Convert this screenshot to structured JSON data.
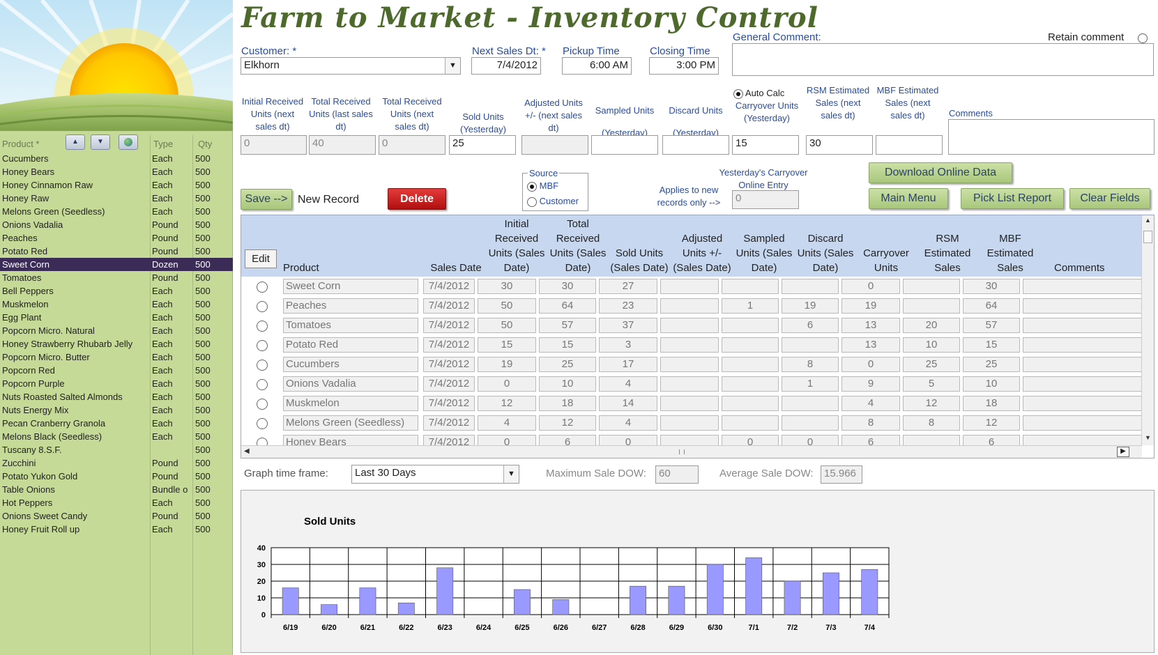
{
  "app": {
    "title": "Farm to Market - Inventory Control"
  },
  "product_list": {
    "headers": {
      "product": "Product *",
      "type": "Type",
      "qty": "Qty"
    },
    "rows": [
      {
        "name": "Cucumbers",
        "type": "Each",
        "qty": "500"
      },
      {
        "name": "Honey Bears",
        "type": "Each",
        "qty": "500"
      },
      {
        "name": "Honey Cinnamon Raw",
        "type": "Each",
        "qty": "500"
      },
      {
        "name": "Honey Raw",
        "type": "Each",
        "qty": "500"
      },
      {
        "name": "Melons Green (Seedless)",
        "type": "Each",
        "qty": "500"
      },
      {
        "name": "Onions Vadalia",
        "type": "Pound",
        "qty": "500"
      },
      {
        "name": "Peaches",
        "type": "Pound",
        "qty": "500"
      },
      {
        "name": "Potato Red",
        "type": "Pound",
        "qty": "500"
      },
      {
        "name": "Sweet Corn",
        "type": "Dozen",
        "qty": "500"
      },
      {
        "name": "Tomatoes",
        "type": "Pound",
        "qty": "500"
      },
      {
        "name": "Bell Peppers",
        "type": "Each",
        "qty": "500"
      },
      {
        "name": "Muskmelon",
        "type": "Each",
        "qty": "500"
      },
      {
        "name": "Egg Plant",
        "type": "Each",
        "qty": "500"
      },
      {
        "name": "Popcorn Micro. Natural",
        "type": "Each",
        "qty": "500"
      },
      {
        "name": "Honey Strawberry Rhubarb Jelly",
        "type": "Each",
        "qty": "500"
      },
      {
        "name": "Popcorn Micro. Butter",
        "type": "Each",
        "qty": "500"
      },
      {
        "name": "Popcorn Red",
        "type": "Each",
        "qty": "500"
      },
      {
        "name": "Popcorn Purple",
        "type": "Each",
        "qty": "500"
      },
      {
        "name": "Nuts Roasted Salted Almonds",
        "type": "Each",
        "qty": "500"
      },
      {
        "name": "Nuts Energy Mix",
        "type": "Each",
        "qty": "500"
      },
      {
        "name": "Pecan Cranberry Granola",
        "type": "Each",
        "qty": "500"
      },
      {
        "name": "Melons Black (Seedless)",
        "type": "Each",
        "qty": "500"
      },
      {
        "name": "Tuscany 8.S.F.",
        "type": "",
        "qty": "500"
      },
      {
        "name": "Zucchini",
        "type": "Pound",
        "qty": "500"
      },
      {
        "name": "Potato Yukon Gold",
        "type": "Pound",
        "qty": "500"
      },
      {
        "name": "Table Onions",
        "type": "Bundle o",
        "qty": "500"
      },
      {
        "name": "Hot Peppers",
        "type": "Each",
        "qty": "500"
      },
      {
        "name": "Onions Sweet Candy",
        "type": "Pound",
        "qty": "500"
      },
      {
        "name": "Honey Fruit Roll up",
        "type": "Each",
        "qty": "500"
      }
    ],
    "selected_index": 8
  },
  "form": {
    "customer_label": "Customer: *",
    "customer_value": "Elkhorn",
    "next_sales_label": "Next Sales Dt: *",
    "next_sales_value": "7/4/2012",
    "pickup_label": "Pickup Time",
    "pickup_value": "6:00 AM",
    "closing_label": "Closing Time",
    "closing_value": "3:00 PM",
    "general_comment_label": "General Comment:",
    "general_comment_value": "",
    "retain_comment_label": "Retain comment"
  },
  "entry": {
    "headers": {
      "initial": "Initial Received Units (next sales dt)",
      "total_last": "Total Received Units (last sales dt)",
      "total_next": "Total Received Units (next sales dt)",
      "sold": "Sold Units (Yesterday)",
      "adjusted": "Adjusted Units +/- (next sales dt)",
      "sampled": "Sampled Units (Yesterday)",
      "discard": "Discard Units (Yesterday)",
      "auto_calc": "Auto Calc",
      "carryover": "Carryover Units (Yesterday)",
      "rsm": "RSM Estimated Sales (next sales dt)",
      "mbf": "MBF Estimated Sales (next sales dt)",
      "comments": "Comments"
    },
    "values": {
      "initial": "0",
      "total_last": "40",
      "total_next": "0",
      "sold": "25",
      "adjusted": "",
      "sampled": "",
      "discard": "",
      "carryover": "15",
      "rsm": "30",
      "mbf": "",
      "comments": ""
    }
  },
  "actions": {
    "save": "Save -->",
    "status": "New Record",
    "delete": "Delete",
    "source_label": "Source",
    "source_mbf": "MBF",
    "source_customer": "Customer",
    "applies_note": "Applies to new records only -->",
    "yesterday_carryover_label": "Yesterday's Carryover Online Entry",
    "yesterday_carryover_value": "0",
    "download": "Download Online Data",
    "main_menu": "Main Menu",
    "pick_list": "Pick List Report",
    "clear": "Clear Fields"
  },
  "grid": {
    "edit_label": "Edit",
    "headers": {
      "product": "Product",
      "sales_date": "Sales Date",
      "initial": "Initial Received Units (Sales Date)",
      "total": "Total Received Units (Sales Date)",
      "sold": "Sold Units (Sales Date)",
      "adjusted": "Adjusted Units +/- (Sales Date)",
      "sampled": "Sampled Units (Sales Date)",
      "discard": "Discard Units (Sales Date)",
      "carryover": "Carryover Units",
      "rsm": "RSM Estimated Sales",
      "mbf": "MBF Estimated Sales",
      "comments": "Comments"
    },
    "rows": [
      {
        "product": "Sweet Corn",
        "date": "7/4/2012",
        "initial": "30",
        "total": "30",
        "sold": "27",
        "adjusted": "",
        "sampled": "",
        "discard": "",
        "carryover": "0",
        "rsm": "",
        "mbf": "30",
        "comments": ""
      },
      {
        "product": "Peaches",
        "date": "7/4/2012",
        "initial": "50",
        "total": "64",
        "sold": "23",
        "adjusted": "",
        "sampled": "1",
        "discard": "19",
        "carryover": "19",
        "rsm": "",
        "mbf": "64",
        "comments": ""
      },
      {
        "product": "Tomatoes",
        "date": "7/4/2012",
        "initial": "50",
        "total": "57",
        "sold": "37",
        "adjusted": "",
        "sampled": "",
        "discard": "6",
        "carryover": "13",
        "rsm": "20",
        "mbf": "57",
        "comments": ""
      },
      {
        "product": "Potato Red",
        "date": "7/4/2012",
        "initial": "15",
        "total": "15",
        "sold": "3",
        "adjusted": "",
        "sampled": "",
        "discard": "",
        "carryover": "13",
        "rsm": "10",
        "mbf": "15",
        "comments": ""
      },
      {
        "product": "Cucumbers",
        "date": "7/4/2012",
        "initial": "19",
        "total": "25",
        "sold": "17",
        "adjusted": "",
        "sampled": "",
        "discard": "8",
        "carryover": "0",
        "rsm": "25",
        "mbf": "25",
        "comments": ""
      },
      {
        "product": "Onions Vadalia",
        "date": "7/4/2012",
        "initial": "0",
        "total": "10",
        "sold": "4",
        "adjusted": "",
        "sampled": "",
        "discard": "1",
        "carryover": "9",
        "rsm": "5",
        "mbf": "10",
        "comments": ""
      },
      {
        "product": "Muskmelon",
        "date": "7/4/2012",
        "initial": "12",
        "total": "18",
        "sold": "14",
        "adjusted": "",
        "sampled": "",
        "discard": "",
        "carryover": "4",
        "rsm": "12",
        "mbf": "18",
        "comments": ""
      },
      {
        "product": "Melons Green (Seedless)",
        "date": "7/4/2012",
        "initial": "4",
        "total": "12",
        "sold": "4",
        "adjusted": "",
        "sampled": "",
        "discard": "",
        "carryover": "8",
        "rsm": "8",
        "mbf": "12",
        "comments": ""
      },
      {
        "product": "Honey Bears",
        "date": "7/4/2012",
        "initial": "0",
        "total": "6",
        "sold": "0",
        "adjusted": "",
        "sampled": "0",
        "discard": "0",
        "carryover": "6",
        "rsm": "",
        "mbf": "6",
        "comments": ""
      }
    ]
  },
  "graph_controls": {
    "timeframe_label": "Graph time frame:",
    "timeframe_value": "Last 30 Days",
    "max_label": "Maximum Sale DOW:",
    "max_value": "60",
    "avg_label": "Average Sale DOW:",
    "avg_value": "15.966"
  },
  "chart_data": {
    "type": "bar",
    "title": "Sold Units",
    "categories": [
      "6/19",
      "6/20",
      "6/21",
      "6/22",
      "6/23",
      "6/24",
      "6/25",
      "6/26",
      "6/27",
      "6/28",
      "6/29",
      "6/30",
      "7/1",
      "7/2",
      "7/3",
      "7/4"
    ],
    "values": [
      16,
      6,
      16,
      7,
      28,
      0,
      15,
      9,
      0,
      17,
      17,
      30,
      34,
      20,
      25,
      27
    ],
    "ylim": [
      0,
      40
    ],
    "yticks": [
      0,
      10,
      20,
      30,
      40
    ],
    "grid": true,
    "bar_color": "#9999ff"
  }
}
